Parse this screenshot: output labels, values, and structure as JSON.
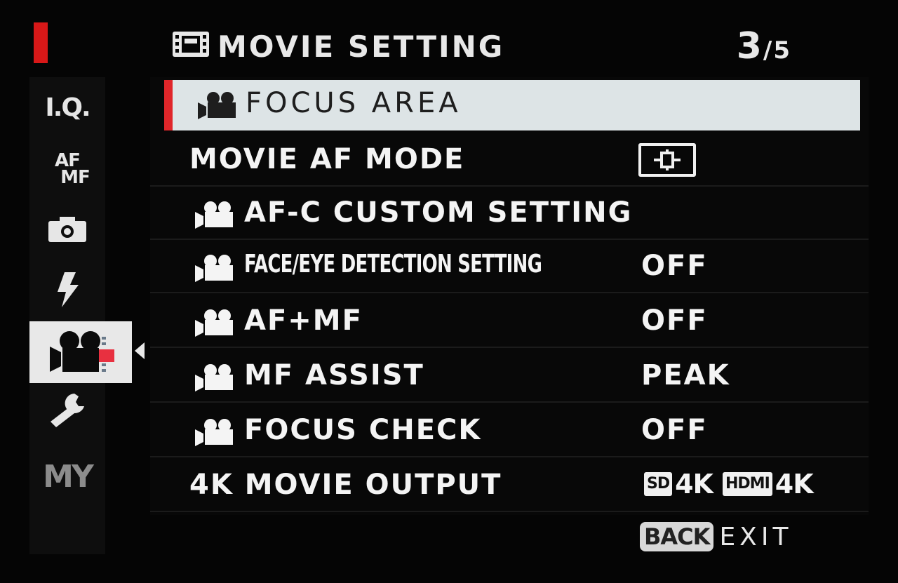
{
  "header": {
    "title": "MOVIE SETTING",
    "page_current": "3",
    "page_separator": "/",
    "page_total": "5"
  },
  "sidebar": {
    "items": [
      {
        "label": "I.Q.",
        "icon": "iq-icon"
      },
      {
        "label_top": "AF",
        "label_bottom": "MF",
        "icon": "af-mf-icon"
      },
      {
        "icon": "camera-icon"
      },
      {
        "icon": "flash-icon"
      },
      {
        "icon": "movie-camera-icon",
        "active": true
      },
      {
        "icon": "wrench-icon"
      },
      {
        "label": "MY",
        "icon": "my-menu-icon"
      }
    ]
  },
  "menu": {
    "items": [
      {
        "label": "FOCUS AREA",
        "icon": "movie-camera-icon",
        "value": ""
      },
      {
        "label": "MOVIE AF MODE",
        "value_icon": "af-area-icon"
      },
      {
        "label": "AF-C CUSTOM SETTING",
        "icon": "movie-camera-icon",
        "value": ""
      },
      {
        "label": "FACE/EYE DETECTION SETTING",
        "icon": "movie-camera-icon",
        "value": "OFF"
      },
      {
        "label": "AF+MF",
        "icon": "movie-camera-icon",
        "value": "OFF"
      },
      {
        "label": "MF ASSIST",
        "icon": "movie-camera-icon",
        "value": "PEAK"
      },
      {
        "label": "FOCUS CHECK",
        "icon": "movie-camera-icon",
        "value": "OFF"
      },
      {
        "label": "4K MOVIE OUTPUT",
        "sd_badge": "SD",
        "sd_value": "4K",
        "hdmi_badge": "HDMI",
        "hdmi_value": "4K"
      }
    ]
  },
  "footer": {
    "back_label": "BACK",
    "exit_label": "EXIT"
  },
  "colors": {
    "background": "#050505",
    "accent_red": "#e0262a",
    "selected_row": "#dde4e6",
    "text": "#f4f4f4"
  }
}
